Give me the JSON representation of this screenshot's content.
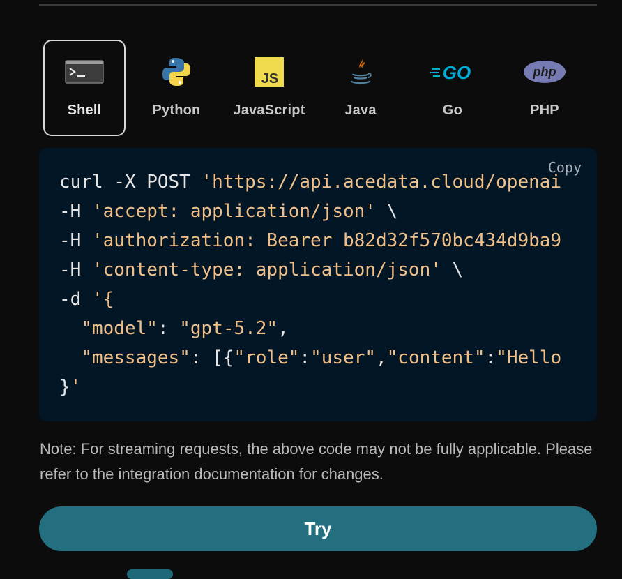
{
  "tabs": [
    {
      "label": "Shell",
      "icon": "terminal-icon",
      "active": true
    },
    {
      "label": "Python",
      "icon": "python-icon",
      "active": false
    },
    {
      "label": "JavaScript",
      "icon": "javascript-icon",
      "active": false
    },
    {
      "label": "Java",
      "icon": "java-icon",
      "active": false
    },
    {
      "label": "Go",
      "icon": "go-icon",
      "active": false
    },
    {
      "label": "PHP",
      "icon": "php-icon",
      "active": false
    }
  ],
  "code": {
    "copy_label": "Copy",
    "lines": [
      "curl -X POST 'https://api.acedata.cloud/openai",
      "-H 'accept: application/json' \\",
      "-H 'authorization: Bearer b82d32f570bc434d9ba9",
      "-H 'content-type: application/json' \\",
      "-d '{",
      "  \"model\": \"gpt-5.2\",",
      "  \"messages\": [{\"role\":\"user\",\"content\":\"Hello",
      "}'"
    ]
  },
  "note": "Note: For streaming requests, the above code may not be fully applicable. Please refer to the integration documentation for changes.",
  "try_button": "Try",
  "colors": {
    "background": "#0c0c0c",
    "code_bg": "#031626",
    "string": "#f1c089",
    "button": "#236f80"
  }
}
